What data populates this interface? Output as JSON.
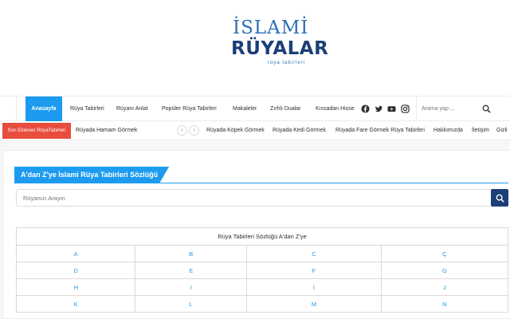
{
  "logo": {
    "top": "İSLAMİ",
    "main": "RÜYALAR",
    "sub": "rüya tabirleri"
  },
  "nav": {
    "items": [
      "Anasayfa",
      "Rüya Tabirleri",
      "Rüyanı Anlat",
      "Popüler Rüya Tabirleri",
      "Makaleler",
      "Zırhlı Dualar",
      "Kıssadan Hisse"
    ],
    "social": [
      "facebook-icon",
      "twitter-icon",
      "youtube-icon",
      "instagram-icon"
    ],
    "search_placeholder": "Arama yap ..."
  },
  "ticker": {
    "label": "Son Eklenen RüyaTabirleri",
    "current": "Rüyada Hamam Görmek",
    "prev": "‹",
    "next": "›",
    "links": [
      "Rüyada Köpek Görmek",
      "Rüyada Kedi Görmek",
      "Rüyada Fare Görmek Rüya Tabirleri",
      "Hakkımızda",
      "İletişim",
      "Gizli"
    ]
  },
  "main": {
    "title": "A'dan Z'ye İslami Rüya Tabirleri Sözlüğü",
    "search_placeholder": "Rüyanızı Arayın",
    "table_caption": "Rüya Tabirleri Sözlüğü A'dan Z'ye",
    "rows": [
      [
        "A",
        "B",
        "C",
        "Ç"
      ],
      [
        "D",
        "E",
        "F",
        "G"
      ],
      [
        "H",
        "I",
        "İ",
        "J"
      ],
      [
        "K",
        "L",
        "M",
        "N"
      ]
    ]
  },
  "colors": {
    "accent": "#1d9bf0",
    "brand_dark": "#1c3f78",
    "ticker_label": "#e74c3c"
  }
}
